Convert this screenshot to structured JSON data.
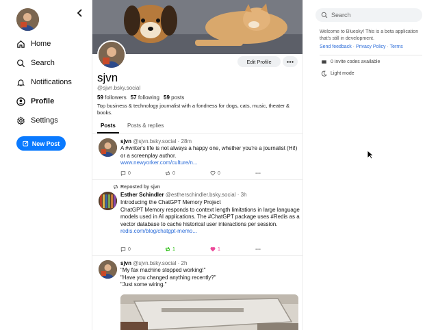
{
  "nav": {
    "items": [
      {
        "label": "Home",
        "icon": "home-icon"
      },
      {
        "label": "Search",
        "icon": "search-icon"
      },
      {
        "label": "Notifications",
        "icon": "bell-icon"
      },
      {
        "label": "Profile",
        "icon": "user-icon"
      },
      {
        "label": "Settings",
        "icon": "gear-icon"
      }
    ],
    "active": "Profile",
    "new_post_label": "New Post"
  },
  "profile": {
    "display_name": "sjvn",
    "handle": "@sjvn.bsky.social",
    "followers_count": "59",
    "followers_label": "followers",
    "following_count": "57",
    "following_label": "following",
    "posts_count": "59",
    "posts_label": "posts",
    "bio": "Top business & technology journalist with a fondness for dogs, cats, music, theater & books.",
    "edit_label": "Edit Profile",
    "tabs": [
      "Posts",
      "Posts & replies"
    ]
  },
  "posts": [
    {
      "author": "sjvn",
      "handle": "@sjvn.bsky.social",
      "time": "28m",
      "text": "A #writer's life is not always a happy one, whether you're a journalist (Hi!) or a screenplay author.",
      "link": "www.newyorker.com/culture/n...",
      "replies": "0",
      "reposts": "0",
      "likes": "0"
    },
    {
      "repost_label": "Reposted by sjvn",
      "author": "Esther Schindler",
      "handle": "@estherschindler.bsky.social",
      "time": "3h",
      "text": "Introducing the ChatGPT Memory Project\nChatGPT Memory responds to context length limitations in large language models used in AI applications. The #ChatGPT package uses #Redis as a vector database to cache historical user interactions per session.",
      "link": "redis.com/blog/chatgpt-memo...",
      "replies": "0",
      "reposts": "1",
      "likes": "1"
    },
    {
      "author": "sjvn",
      "handle": "@sjvn.bsky.social",
      "time": "2h",
      "text": "\"My fax machine stopped working!\"\n\"Have you changed anything recently?\"\n\"Just some wiring.\""
    }
  ],
  "right": {
    "search_placeholder": "Search",
    "welcome": "Welcome to Bluesky! This is a beta application that's still in development.",
    "links": [
      "Send feedback",
      "Privacy Policy",
      "Terms"
    ],
    "separator": "·",
    "invite_codes": "0 invite codes available",
    "theme": "Light mode"
  },
  "colors": {
    "accent": "#0a7aff",
    "link": "#2a6bd8",
    "repost_active": "#20bc07",
    "like_active": "#ec4899"
  }
}
